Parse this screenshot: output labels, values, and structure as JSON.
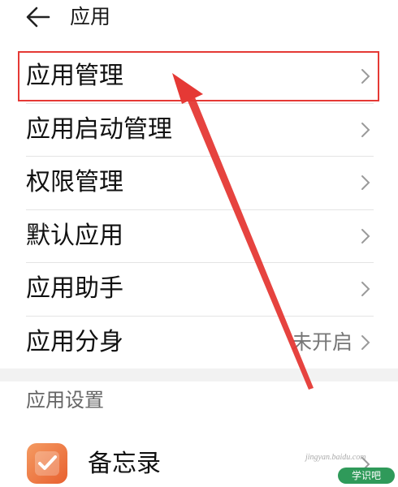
{
  "header": {
    "title": "应用"
  },
  "menu": [
    {
      "label": "应用管理",
      "status": ""
    },
    {
      "label": "应用启动管理",
      "status": ""
    },
    {
      "label": "权限管理",
      "status": ""
    },
    {
      "label": "默认应用",
      "status": ""
    },
    {
      "label": "应用助手",
      "status": ""
    },
    {
      "label": "应用分身",
      "status": "未开启"
    }
  ],
  "section": {
    "title": "应用设置"
  },
  "apps": [
    {
      "label": "备忘录",
      "icon": "memo-checkmark-icon"
    }
  ],
  "annotation": {
    "color": "#e53935"
  },
  "watermark": {
    "site": "jingyan.baidu.com",
    "badge": "学识吧"
  }
}
